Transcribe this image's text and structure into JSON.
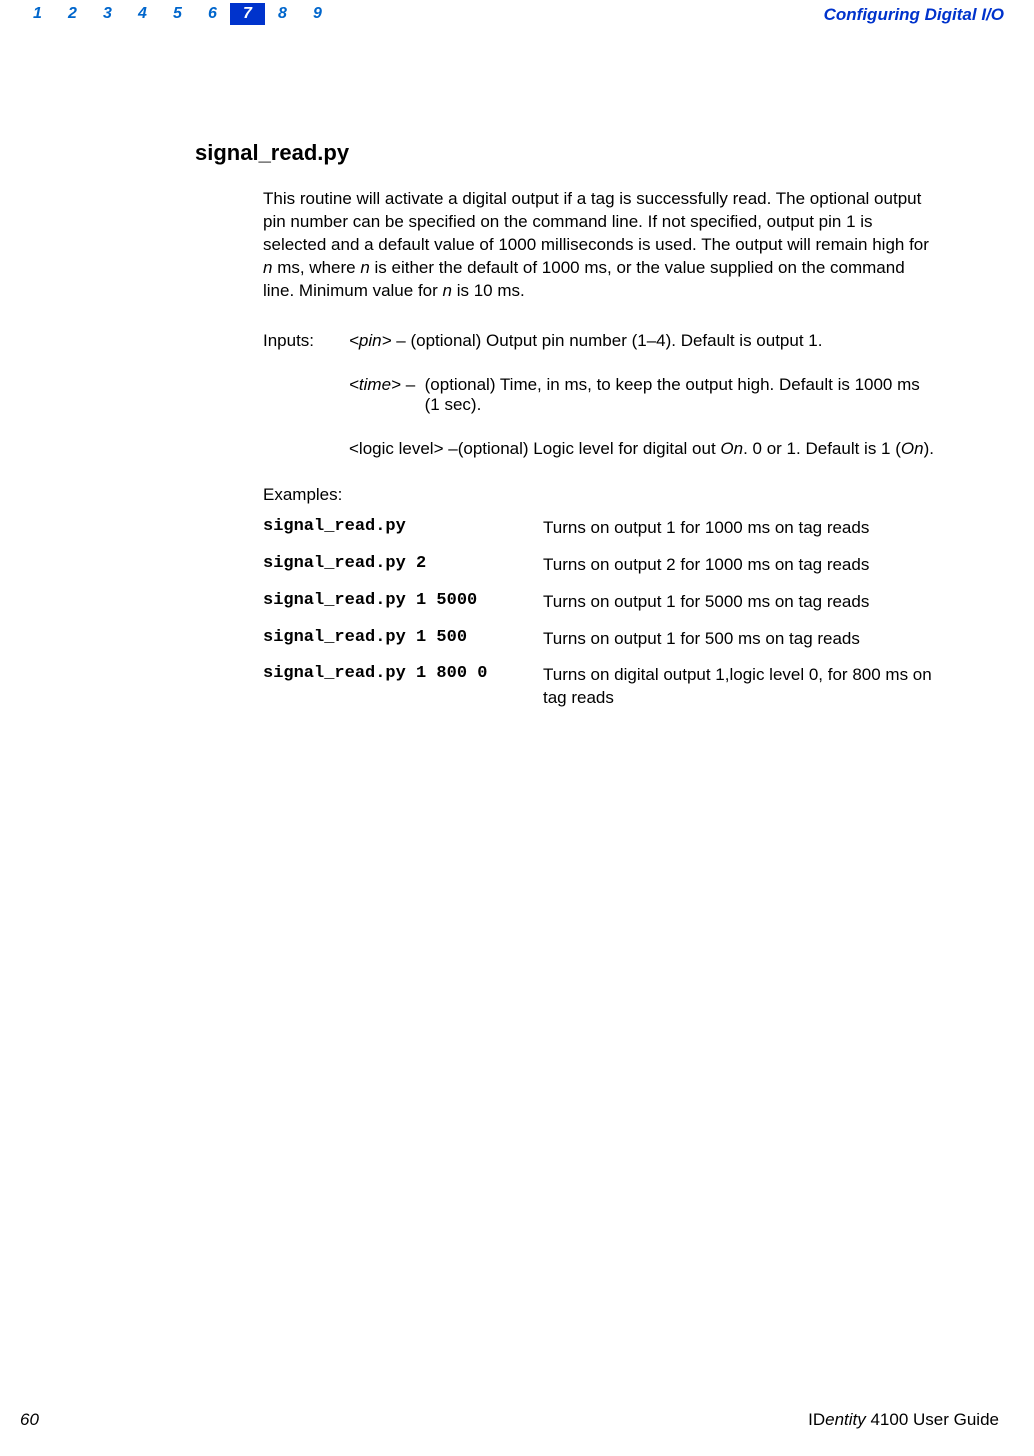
{
  "header": {
    "chapters": [
      "1",
      "2",
      "3",
      "4",
      "5",
      "6",
      "7",
      "8",
      "9"
    ],
    "current_chapter_index": 6,
    "title": "Configuring Digital I/O"
  },
  "section": {
    "title": "signal_read.py",
    "desc_part1": "This routine will activate a digital output if a tag is successfully read. The optional output pin number can be specified on the command line. If not specified, output pin 1 is selected and a default value of 1000 milliseconds is used. The output will remain high for ",
    "desc_n1": "n",
    "desc_part2": " ms, where ",
    "desc_n2": "n",
    "desc_part3": " is either the default of 1000 ms, or the value supplied on the command line. Minimum value for ",
    "desc_n3": "n",
    "desc_part4": " is 10 ms."
  },
  "inputs": {
    "label": "Inputs:",
    "pin_name": "<pin>",
    "pin_desc": " – (optional) Output pin number (1–4). Default is output 1.",
    "time_name": "<time>",
    "time_sep": " – ",
    "time_desc": "(optional) Time, in ms, to keep the output high. Default is 1000 ms (1 sec).",
    "logic_name": "<logic level>",
    "logic_sep": " – ",
    "logic_desc1": "(optional) Logic level for digital out ",
    "logic_on1": "On",
    "logic_desc2": ". 0 or 1. Default is 1 (",
    "logic_on2": "On",
    "logic_desc3": ")."
  },
  "examples": {
    "label": "Examples:",
    "rows": [
      {
        "cmd": "signal_read.py",
        "desc": "Turns on output 1 for 1000 ms on tag reads"
      },
      {
        "cmd": "signal_read.py 2",
        "desc": "Turns on output 2 for 1000 ms on tag reads"
      },
      {
        "cmd": "signal_read.py 1 5000",
        "desc": "Turns on output 1 for 5000 ms on tag reads"
      },
      {
        "cmd": "signal_read.py 1 500",
        "desc": "Turns on output 1 for 500 ms on tag reads"
      },
      {
        "cmd": "signal_read.py 1 800 0",
        "desc": "Turns on digital output 1,logic level 0, for 800 ms on tag reads"
      }
    ]
  },
  "footer": {
    "page_number": "60",
    "brand_i": "ID",
    "brand_entity": "entity",
    "brand_rest": " 4100 User Guide"
  }
}
